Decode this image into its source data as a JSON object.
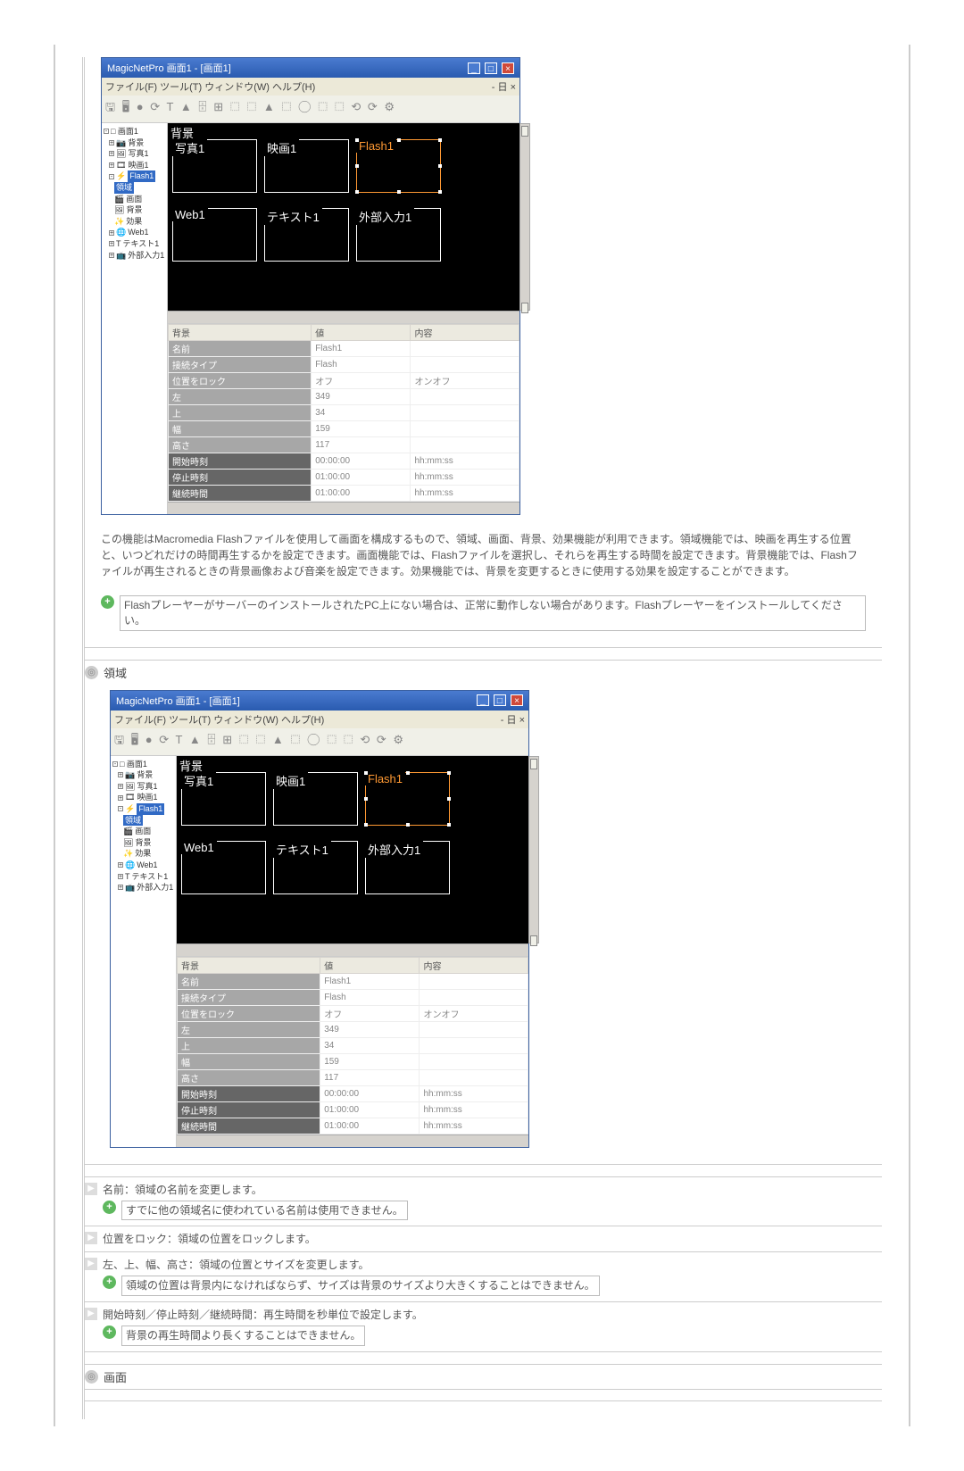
{
  "app": {
    "title": "MagicNetPro 画面1 - [画面1]",
    "menubar": {
      "left": "ファイル(F)  ツール(T)  ウィンドウ(W)  ヘルプ(H)",
      "right": "- 日 ×"
    },
    "winbtns": {
      "min": "_",
      "max": "□",
      "close": "×"
    },
    "toolbar_glyphs": "🖫 🖥 ● ⟳ T ▲ 🗄 ⊞ ⬚ ⬚ ▲ ⬚ ◯ ⬚ ⬚ ⟲ ⟳ ⚙"
  },
  "tree": {
    "root": "□ 画面1",
    "items": [
      "背景",
      "写真1",
      "映画1",
      "Flash1",
      "領域",
      "画面",
      "背景",
      "効果",
      "Web1",
      "テキスト1",
      "外部入力1"
    ],
    "selected_a": "Flash1",
    "selected_b": "領域"
  },
  "canvas": {
    "bg_label": "背景",
    "slots": {
      "photo1": "写真1",
      "movie1": "映画1",
      "flash1": "Flash1",
      "web1": "Web1",
      "text1": "テキスト1",
      "ext1": "外部入力1"
    }
  },
  "props": {
    "headers": {
      "c1": "背景",
      "c2": "値",
      "c3": "内容"
    },
    "rows": [
      {
        "label": "名前",
        "v": "Flash1",
        "c": ""
      },
      {
        "label": "接続タイプ",
        "v": "Flash",
        "c": ""
      },
      {
        "label": "位置をロック",
        "v": "オフ",
        "c": "オンオフ"
      },
      {
        "label": "左",
        "v": "349",
        "c": ""
      },
      {
        "label": "上",
        "v": "34",
        "c": ""
      },
      {
        "label": "幅",
        "v": "159",
        "c": ""
      },
      {
        "label": "高さ",
        "v": "117",
        "c": ""
      },
      {
        "label": "開始時刻",
        "v": "00:00:00",
        "c": "hh:mm:ss"
      },
      {
        "label": "停止時刻",
        "v": "01:00:00",
        "c": "hh:mm:ss"
      },
      {
        "label": "継続時間",
        "v": "01:00:00",
        "c": "hh:mm:ss"
      }
    ]
  },
  "desc": "この機能はMacromedia Flashファイルを使用して画面を構成するもので、領域、画面、背景、効果機能が利用できます。領域機能では、映画を再生する位置と、いつどれだけの時間再生するかを設定できます。画面機能では、Flashファイルを選択し、それらを再生する時間を設定できます。背景機能では、Flashファイルが再生されるときの背景画像および音楽を設定できます。効果機能では、背景を変更するときに使用する効果を設定することができます。",
  "tip1": "FlashプレーヤーがサーバーのインストールされたPC上にない場合は、正常に動作しない場合があります。Flashプレーヤーをインストールしてください。",
  "section_area": "領域",
  "items": {
    "name": {
      "text": "名前：領域の名前を変更します。",
      "tip": "すでに他の領域名に使われている名前は使用できません。"
    },
    "lock": {
      "text": "位置をロック：領域の位置をロックします。"
    },
    "pos": {
      "text": "左、上、幅、高さ：領域の位置とサイズを変更します。",
      "tip": "領域の位置は背景内になければならず、サイズは背景のサイズより大きくすることはできません。"
    },
    "time": {
      "text": "開始時刻／停止時刻／継続時間：再生時間を秒単位で設定します。",
      "tip": "背景の再生時間より長くすることはできません。"
    }
  },
  "section_screen": "画面",
  "tip_icon": "+",
  "bullet_icon": "◎",
  "item_bullet": "▶"
}
